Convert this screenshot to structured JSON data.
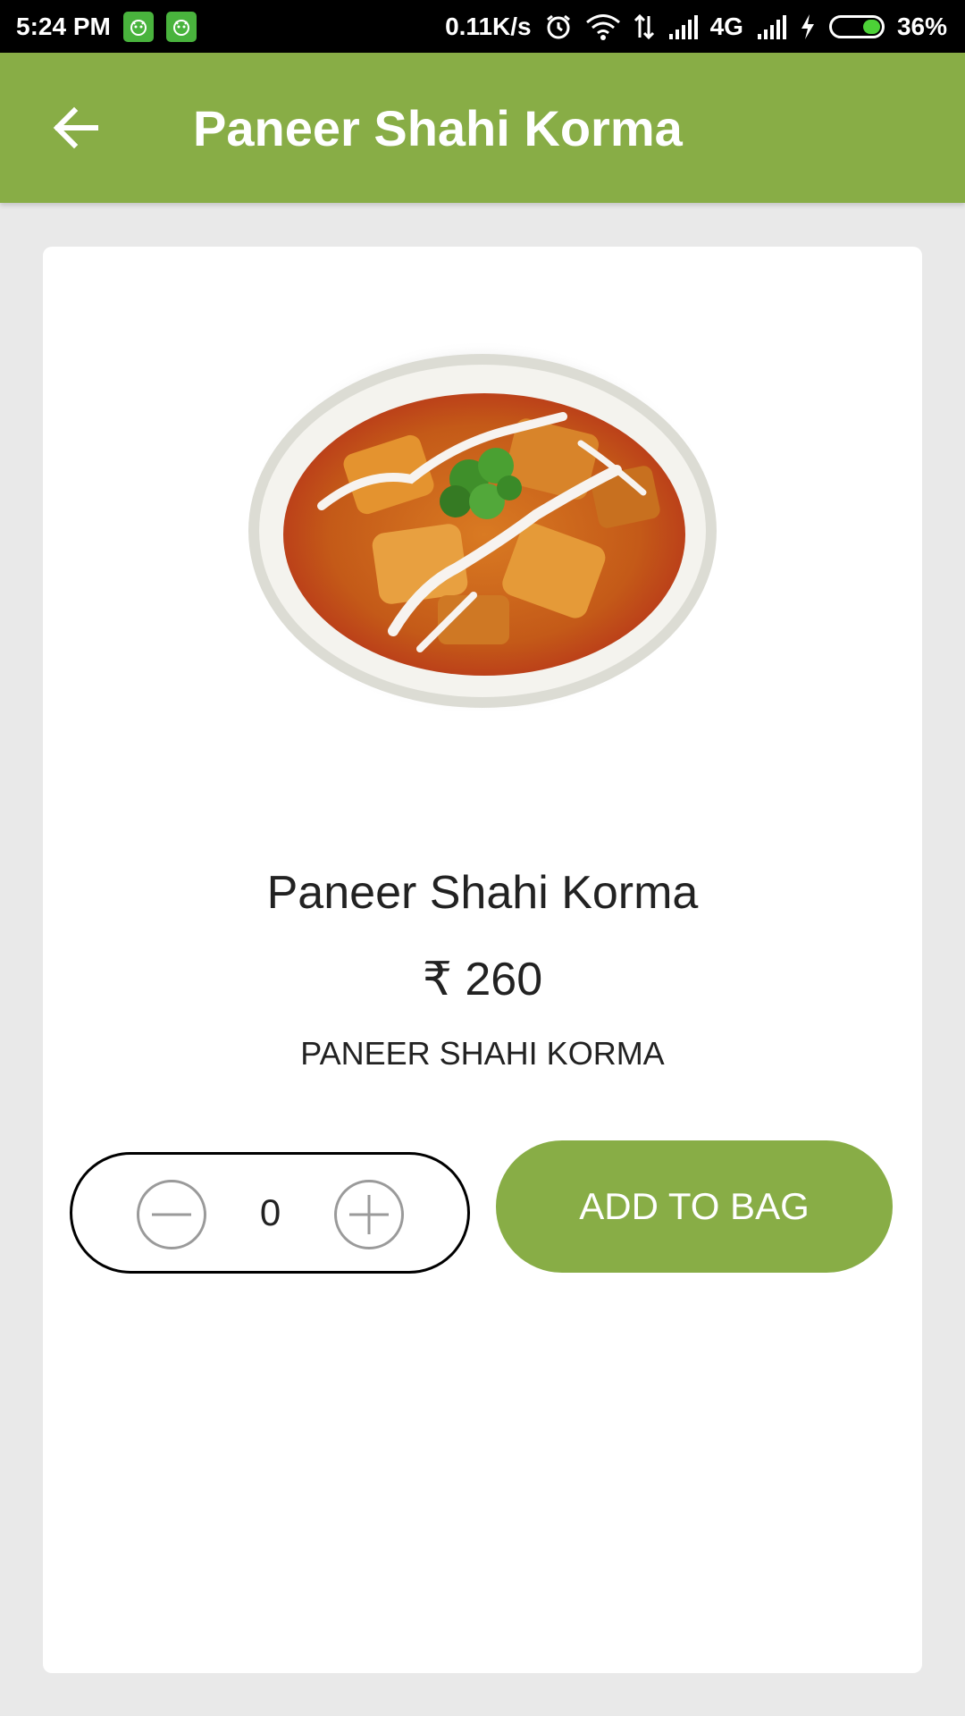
{
  "status_bar": {
    "time": "5:24 PM",
    "network_speed": "0.11K/s",
    "network_type": "4G",
    "battery": "36%",
    "battery_level": 0.36,
    "icons": [
      "notification-app-icon",
      "notification-app-icon",
      "alarm-icon",
      "wifi-icon",
      "data-transfer-icon",
      "signal-icon",
      "signal-icon",
      "charging-icon",
      "battery-icon"
    ]
  },
  "app_bar": {
    "title": "Paneer Shahi Korma",
    "back_icon": "arrow-left-icon",
    "background_color": "#88ad46"
  },
  "product": {
    "name": "Paneer Shahi Korma",
    "price": "₹ 260",
    "description": "PANEER SHAHI KORMA",
    "image": "paneer-shahi-korma-dish-photo"
  },
  "quantity": {
    "value": "0",
    "decrement_icon": "minus-circle-icon",
    "increment_icon": "plus-circle-icon"
  },
  "actions": {
    "add_to_bag_label": "ADD TO BAG"
  },
  "colors": {
    "accent": "#88ad46",
    "page_background": "#e9e9e9",
    "card_background": "#ffffff"
  }
}
